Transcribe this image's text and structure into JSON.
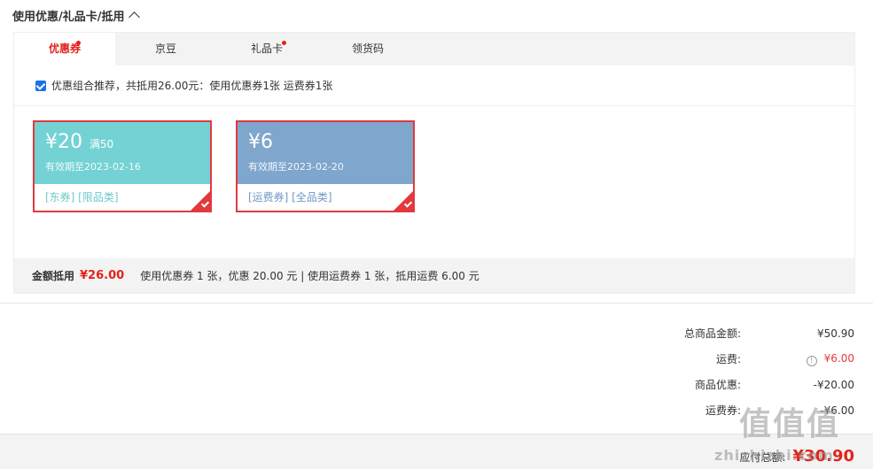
{
  "section": {
    "title": "使用优惠/礼品卡/抵用"
  },
  "tabs": [
    {
      "label": "优惠券",
      "dot": true,
      "active": true
    },
    {
      "label": "京豆",
      "dot": false,
      "active": false
    },
    {
      "label": "礼品卡",
      "dot": true,
      "active": false
    },
    {
      "label": "领货码",
      "dot": false,
      "active": false
    }
  ],
  "combo": {
    "text": "优惠组合推荐，共抵用26.00元：使用优惠券1张 运费券1张",
    "checked": true
  },
  "coupons": [
    {
      "amount": "¥20",
      "condition": "满50",
      "expiry": "有效期至2023-02-16",
      "tags": "[东券]  [限品类]",
      "color": "#74d2d4",
      "tagColor": "#6fc8cc",
      "selected": true
    },
    {
      "amount": "¥6",
      "condition": "",
      "expiry": "有效期至2023-02-20",
      "tags": "[运费券]  [全品类]",
      "color": "#7fa6cc",
      "tagColor": "#6f98c2",
      "selected": true
    }
  ],
  "summary": {
    "label": "金额抵用",
    "amount": "¥26.00",
    "detail": "使用优惠券 1 张，优惠 20.00 元  | 使用运费券 1 张，抵用运费 6.00 元"
  },
  "totals": {
    "goods_label": "总商品金额:",
    "goods_value": "¥50.90",
    "shipping_label": "运费:",
    "shipping_value": "¥6.00",
    "discount_label": "商品优惠:",
    "discount_value": "-¥20.00",
    "shipcoupon_label": "运费券:",
    "shipcoupon_value": "-¥6.00"
  },
  "footer": {
    "pay_label": "应付总额:",
    "pay_value": "¥30.90"
  },
  "watermark": {
    "main": "值值值",
    "sub": "zhizhizhi.com"
  },
  "colors": {
    "accent": "#e2231a",
    "orange": "#e4393c"
  }
}
